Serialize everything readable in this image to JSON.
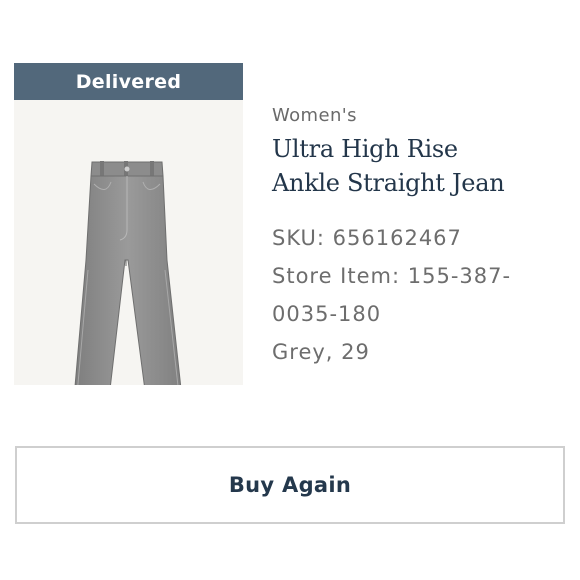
{
  "order_item": {
    "status": "Delivered",
    "category": "Women's",
    "title_line1": "Ultra High Rise",
    "title_line2": "Ankle Straight Jean",
    "sku_line": "SKU: 656162467",
    "store_item_line1": "Store Item: 155-387-",
    "store_item_line2": "0035-180",
    "variant": "Grey, 29",
    "image_icon": "jeans-product-image"
  },
  "actions": {
    "buy_again_label": "Buy Again"
  },
  "colors": {
    "banner": "#52687b",
    "title": "#23364a",
    "button_text": "#24384c",
    "jean": "#8a8a8a"
  }
}
